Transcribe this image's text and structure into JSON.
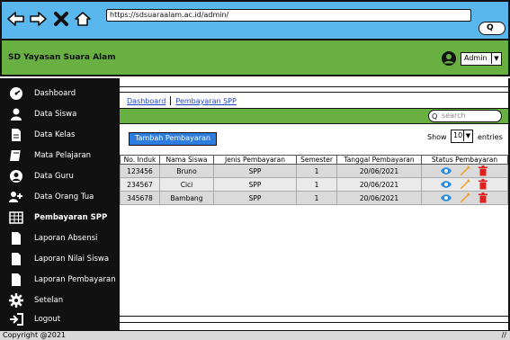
{
  "browser": {
    "url": "https://sdsuaraalam.ac.id/admin/",
    "search_icon_label": "Q"
  },
  "header": {
    "title": "SD Yayasan Suara Alam",
    "user_menu": "Admin"
  },
  "sidebar": {
    "items": [
      {
        "label": "Dashboard",
        "icon": "dashboard-icon"
      },
      {
        "label": "Data Siswa",
        "icon": "user-icon"
      },
      {
        "label": "Data Kelas",
        "icon": "document-icon"
      },
      {
        "label": "Mata Pelajaran",
        "icon": "book-icon"
      },
      {
        "label": "Data Guru",
        "icon": "user-circle-icon"
      },
      {
        "label": "Data Orang Tua",
        "icon": "add-user-icon"
      },
      {
        "label": "Pembayaran SPP",
        "icon": "table-icon"
      },
      {
        "label": "Laporan Absensi",
        "icon": "file-icon"
      },
      {
        "label": "Laporan Nilai Siswa",
        "icon": "file-icon"
      },
      {
        "label": "Laporan Pembayaran",
        "icon": "file-icon"
      },
      {
        "label": "Setelan",
        "icon": "gear-icon"
      },
      {
        "label": "Logout",
        "icon": "logout-icon"
      }
    ],
    "active": "Pembayaran SPP"
  },
  "main": {
    "breadcrumb": [
      "Dashboard",
      "Pembayaran SPP"
    ],
    "search_placeholder": "search",
    "add_button": "Tambah Pembayaran",
    "show_label": "Show",
    "show_value": "10",
    "entries_label": "entries",
    "table": {
      "headers": [
        "No. Induk",
        "Nama Siswa",
        "Jenis Pembayaran",
        "Semester",
        "Tanggal Pembayaran",
        "Status Pembayaran"
      ],
      "rows": [
        {
          "no_induk": "123456",
          "nama": "Bruno",
          "jenis": "SPP",
          "semester": "1",
          "tanggal": "20/06/2021"
        },
        {
          "no_induk": "234567",
          "nama": "Cici",
          "jenis": "SPP",
          "semester": "1",
          "tanggal": "20/06/2021"
        },
        {
          "no_induk": "345678",
          "nama": "Bambang",
          "jenis": "SPP",
          "semester": "1",
          "tanggal": "20/06/2021"
        }
      ]
    }
  },
  "footer": {
    "copyright": "Copyright @2021"
  },
  "colors": {
    "header_green": "#69b043",
    "browser_blue": "#59b7ee",
    "button_blue": "#2e7ce0",
    "delete_red": "#e02020",
    "edit_orange": "#f0a020",
    "view_blue": "#2a8be0"
  }
}
